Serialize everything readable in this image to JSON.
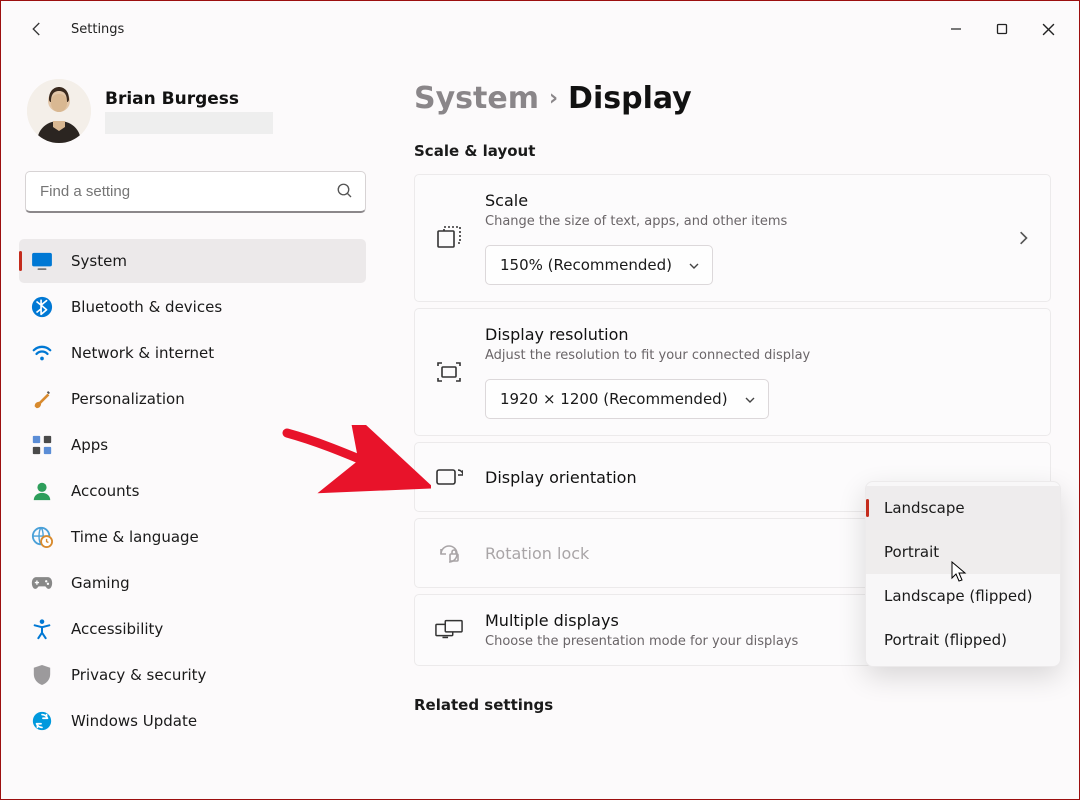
{
  "window": {
    "title": "Settings"
  },
  "profile": {
    "name": "Brian Burgess"
  },
  "search": {
    "placeholder": "Find a setting"
  },
  "sidebar": {
    "items": [
      {
        "label": "System",
        "active": true
      },
      {
        "label": "Bluetooth & devices"
      },
      {
        "label": "Network & internet"
      },
      {
        "label": "Personalization"
      },
      {
        "label": "Apps"
      },
      {
        "label": "Accounts"
      },
      {
        "label": "Time & language"
      },
      {
        "label": "Gaming"
      },
      {
        "label": "Accessibility"
      },
      {
        "label": "Privacy & security"
      },
      {
        "label": "Windows Update"
      }
    ]
  },
  "breadcrumb": {
    "parent": "System",
    "current": "Display"
  },
  "sections": {
    "scale_layout": "Scale & layout",
    "related": "Related settings"
  },
  "cards": {
    "scale": {
      "title": "Scale",
      "subtitle": "Change the size of text, apps, and other items",
      "selected": "150% (Recommended)"
    },
    "resolution": {
      "title": "Display resolution",
      "subtitle": "Adjust the resolution to fit your connected display",
      "selected": "1920 × 1200 (Recommended)"
    },
    "orientation": {
      "title": "Display orientation"
    },
    "rotation": {
      "title": "Rotation lock"
    },
    "multiple": {
      "title": "Multiple displays",
      "subtitle": "Choose the presentation mode for your displays"
    }
  },
  "orientation_options": {
    "selected": "Landscape",
    "hovered": "Portrait",
    "opt3": "Landscape (flipped)",
    "opt4": "Portrait (flipped)"
  }
}
